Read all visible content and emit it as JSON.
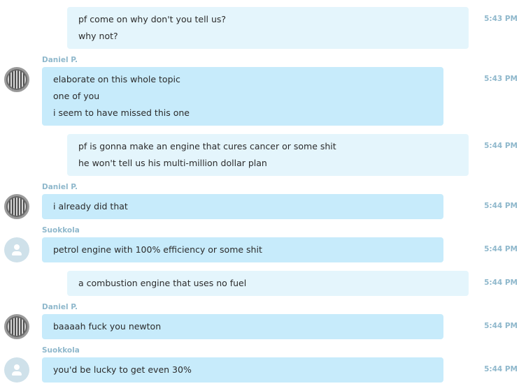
{
  "messages": [
    {
      "sender": "",
      "outgoing": true,
      "time": "5:43 PM",
      "lines": [
        "pf come on why don't you tell us?",
        "why not?"
      ]
    },
    {
      "sender": "Daniel P.",
      "avatar": "grill-avatar",
      "outgoing": false,
      "time": "5:43 PM",
      "lines": [
        "elaborate on this whole topic",
        "one of you",
        "i seem to have missed this one"
      ]
    },
    {
      "sender": "",
      "outgoing": true,
      "time": "5:44 PM",
      "lines": [
        "pf is gonna make an engine that cures cancer or some shit",
        "he won't tell us his multi-million dollar plan"
      ]
    },
    {
      "sender": "Daniel P.",
      "avatar": "grill-avatar",
      "outgoing": false,
      "time": "5:44 PM",
      "lines": [
        "i already did that"
      ]
    },
    {
      "sender": "Suokkola",
      "avatar": "default-person-avatar",
      "outgoing": false,
      "time": "5:44 PM",
      "lines": [
        "petrol engine with 100% efficiency or some shit"
      ]
    },
    {
      "sender": "",
      "outgoing": true,
      "time": "5:44 PM",
      "lines": [
        "a combustion engine that uses no fuel"
      ]
    },
    {
      "sender": "Daniel P.",
      "avatar": "grill-avatar",
      "outgoing": false,
      "time": "5:44 PM",
      "lines": [
        "baaaah fuck you newton"
      ]
    },
    {
      "sender": "Suokkola",
      "avatar": "default-person-avatar",
      "outgoing": false,
      "time": "5:44 PM",
      "lines": [
        "you'd be lucky to get even 30%"
      ]
    }
  ],
  "colors": {
    "incoming_bubble": "#c7ebfb",
    "outgoing_bubble": "#e4f5fc",
    "meta_text": "#8fb8cc",
    "message_text": "#2b2b2b"
  }
}
